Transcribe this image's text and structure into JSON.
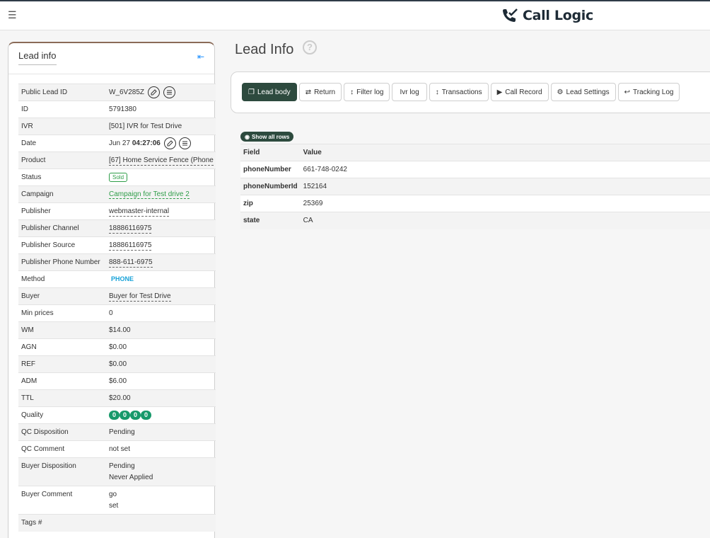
{
  "app": {
    "name": "Call Logic"
  },
  "lead_card": {
    "title": "Lead info",
    "rows": [
      {
        "label": "Public Lead ID",
        "value": "W_6V285Z"
      },
      {
        "label": "ID",
        "value": "5791380"
      },
      {
        "label": "IVR",
        "value": "[501] IVR for Test Drive"
      },
      {
        "label": "Date",
        "date": "Jun 27",
        "time": "04:27:06"
      },
      {
        "label": "Product",
        "value": "[67] Home Service Fence (Phone"
      },
      {
        "label": "Status",
        "value": "Sold"
      },
      {
        "label": "Campaign",
        "value": "Campaign for Test drive 2"
      },
      {
        "label": "Publisher",
        "value": "webmaster-internal"
      },
      {
        "label": "Publisher Channel",
        "value": "18886116975"
      },
      {
        "label": "Publisher Source",
        "value": "18886116975"
      },
      {
        "label": "Publisher Phone Number",
        "value": "888-611-6975"
      },
      {
        "label": "Method",
        "value": "PHONE"
      },
      {
        "label": "Buyer",
        "value": "Buyer for Test Drive"
      },
      {
        "label": "Min prices",
        "value": "0"
      },
      {
        "label": "WM",
        "value": "$14.00"
      },
      {
        "label": "AGN",
        "value": "$0.00"
      },
      {
        "label": "REF",
        "value": "$0.00"
      },
      {
        "label": "ADM",
        "value": "$6.00"
      },
      {
        "label": "TTL",
        "value": "$20.00"
      },
      {
        "label": "Quality",
        "dots": [
          "0",
          "0",
          "0",
          "0"
        ]
      },
      {
        "label": "QC Disposition",
        "value": "Pending"
      },
      {
        "label": "QC Comment",
        "value": "not set"
      },
      {
        "label": "Buyer Disposition",
        "line1": "Pending",
        "line2": "Never Applied"
      },
      {
        "label": "Buyer Comment",
        "line1": "go",
        "line2": "set"
      },
      {
        "label": "Tags #",
        "value": ""
      }
    ]
  },
  "main": {
    "title": "Lead Info",
    "help": "?",
    "tabs": [
      {
        "label": "Lead body",
        "icon": "copy-icon"
      },
      {
        "label": "Return",
        "icon": "swap-icon"
      },
      {
        "label": "Filter log",
        "icon": "updown-icon"
      },
      {
        "label": "Ivr log",
        "icon": ""
      },
      {
        "label": "Transactions",
        "icon": "updown-icon"
      },
      {
        "label": "Call Record",
        "icon": "play-icon"
      },
      {
        "label": "Lead Settings",
        "icon": "gear-icon"
      },
      {
        "label": "Tracking Log",
        "icon": "reply-icon"
      }
    ],
    "show_all_rows": "Show all rows",
    "table": {
      "headers": [
        "Field",
        "Value"
      ],
      "rows": [
        [
          "phoneNumber",
          "661-748-0242"
        ],
        [
          "phoneNumberId",
          "152164"
        ],
        [
          "zip",
          "25369"
        ],
        [
          "state",
          "CA"
        ]
      ]
    }
  },
  "colors": {
    "accent": "#2d4a3e",
    "green": "#2e9d48",
    "quality": "#17996a",
    "link_blue": "#17a2d8"
  }
}
